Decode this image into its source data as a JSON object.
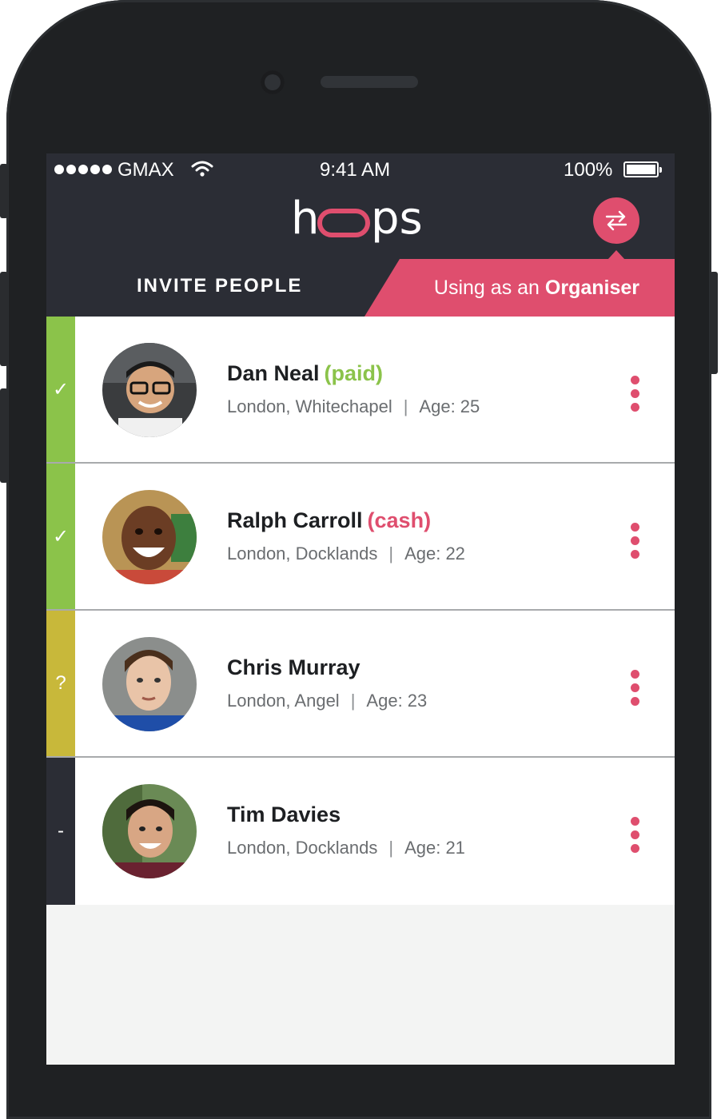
{
  "status_bar": {
    "carrier": "GMAX",
    "time": "9:41 AM",
    "battery": "100%"
  },
  "header": {
    "logo": "hoops",
    "title": "INVITE PEOPLE",
    "role_prefix": "Using as an ",
    "role_value": "Organiser",
    "swap_icon": "swap-arrows-icon"
  },
  "colors": {
    "accent": "#df4e6e",
    "header_bg": "#2b2d35",
    "paid_green": "#8bc34a",
    "pending_yellow": "#c8b83a",
    "none_dark": "#2b2d35"
  },
  "people": [
    {
      "name": "Dan Neal",
      "tag": "(paid)",
      "tag_color": "#8bc34a",
      "location": "London, Whitechapel",
      "age": "Age: 25",
      "status_symbol": "✓",
      "status_color": "#8bc34a"
    },
    {
      "name": "Ralph Carroll",
      "tag": "(cash)",
      "tag_color": "#df4e6e",
      "location": "London, Docklands",
      "age": "Age: 22",
      "status_symbol": "✓",
      "status_color": "#8bc34a"
    },
    {
      "name": "Chris Murray",
      "tag": "",
      "tag_color": "",
      "location": "London, Angel",
      "age": "Age: 23",
      "status_symbol": "?",
      "status_color": "#c8b83a"
    },
    {
      "name": "Tim Davies",
      "tag": "",
      "tag_color": "",
      "location": "London, Docklands",
      "age": "Age: 21",
      "status_symbol": "-",
      "status_color": "#2b2d35"
    }
  ]
}
